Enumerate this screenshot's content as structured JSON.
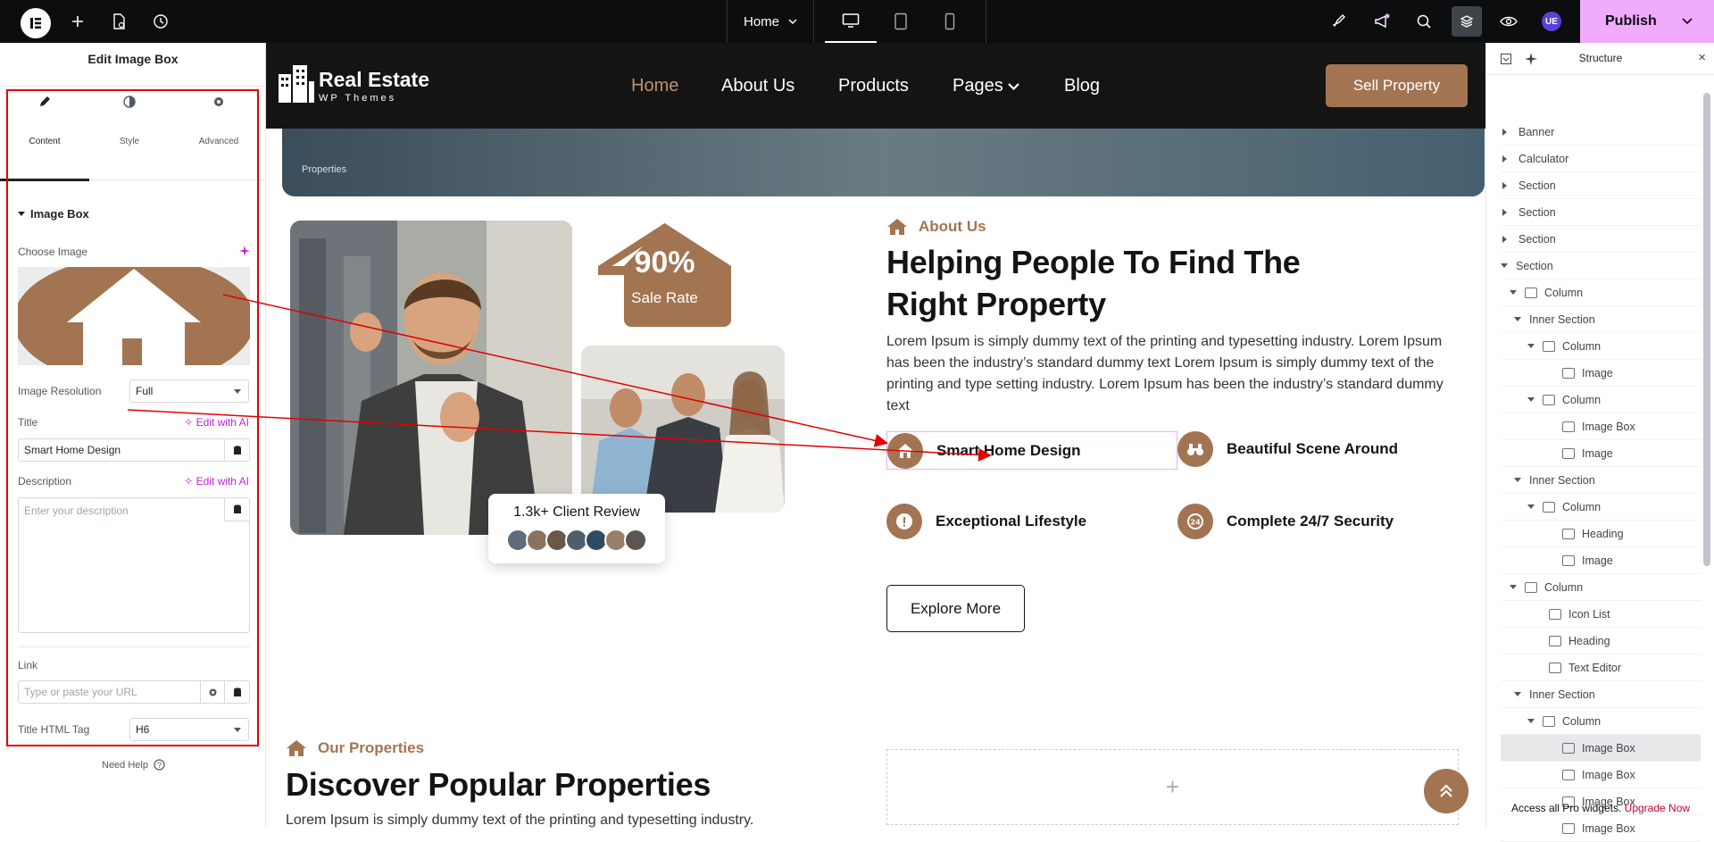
{
  "topbar": {
    "page_name": "Home",
    "publish_label": "Publish",
    "user_initials": "UE",
    "icons": [
      "elementor-logo-icon",
      "plus-icon",
      "page-settings-icon",
      "history-icon",
      "desktop-icon",
      "tablet-icon",
      "mobile-icon",
      "rocket-icon",
      "megaphone-icon",
      "search-icon",
      "structure-icon",
      "preview-eye-icon",
      "chevron-down-icon"
    ]
  },
  "left_panel": {
    "title": "Edit Image Box",
    "tabs": [
      {
        "label": "Content"
      },
      {
        "label": "Style"
      },
      {
        "label": "Advanced"
      }
    ],
    "section_title": "Image Box",
    "choose_image_label": "Choose Image",
    "image_resolution_label": "Image Resolution",
    "image_resolution_value": "Full",
    "title_label": "Title",
    "edit_ai_label": "Edit with AI",
    "title_value": "Smart Home Design",
    "description_label": "Description",
    "description_placeholder": "Enter your description",
    "link_label": "Link",
    "link_placeholder": "Type or paste your URL",
    "title_tag_label": "Title HTML Tag",
    "title_tag_value": "H6",
    "need_help": "Need Help"
  },
  "site": {
    "brand_name": "Real Estate",
    "brand_sub": "WP Themes",
    "nav": [
      {
        "label": "Home"
      },
      {
        "label": "About Us"
      },
      {
        "label": "Products"
      },
      {
        "label": "Pages"
      },
      {
        "label": "Blog"
      }
    ],
    "sell_button": "Sell Property",
    "breadcrumb_partial": "Properties",
    "badge_value": "90%",
    "badge_label": "Sale Rate",
    "review_label": "1.3k+ Client Review",
    "about_tag": "About Us",
    "about_heading": "Helping People To Find The Right Property",
    "about_text": "Lorem Ipsum is simply dummy text of the printing and typesetting industry. Lorem Ipsum has been the industry’s standard dummy text Lorem Ipsum is simply dummy text of the printing and type setting industry. Lorem Ipsum has been the industry’s standard dummy text",
    "features": [
      {
        "label": "Smart Home Design"
      },
      {
        "label": "Beautiful Scene Around"
      },
      {
        "label": "Exceptional Lifestyle"
      },
      {
        "label": "Complete 24/7 Security"
      }
    ],
    "explore_button": "Explore More",
    "props_tag": "Our Properties",
    "props_heading": "Discover Popular Properties",
    "props_text": "Lorem Ipsum is simply dummy text of the printing and typesetting industry.",
    "brand_color": "#a27451"
  },
  "structure": {
    "title": "Structure",
    "items": [
      {
        "label": "Banner"
      },
      {
        "label": "Calculator"
      },
      {
        "label": "Section"
      },
      {
        "label": "Section"
      },
      {
        "label": "Section"
      },
      {
        "label": "Section"
      },
      {
        "label": "Column"
      },
      {
        "label": "Inner Section"
      },
      {
        "label": "Column"
      },
      {
        "label": "Image"
      },
      {
        "label": "Column"
      },
      {
        "label": "Image Box"
      },
      {
        "label": "Image"
      },
      {
        "label": "Inner Section"
      },
      {
        "label": "Column"
      },
      {
        "label": "Heading"
      },
      {
        "label": "Image"
      },
      {
        "label": "Column"
      },
      {
        "label": "Icon List"
      },
      {
        "label": "Heading"
      },
      {
        "label": "Text Editor"
      },
      {
        "label": "Inner Section"
      },
      {
        "label": "Column"
      },
      {
        "label": "Image Box"
      },
      {
        "label": "Image Box"
      },
      {
        "label": "Image Box"
      },
      {
        "label": "Image Box"
      }
    ],
    "footer_text": "Access all Pro widgets.",
    "footer_link": "Upgrade Now"
  }
}
